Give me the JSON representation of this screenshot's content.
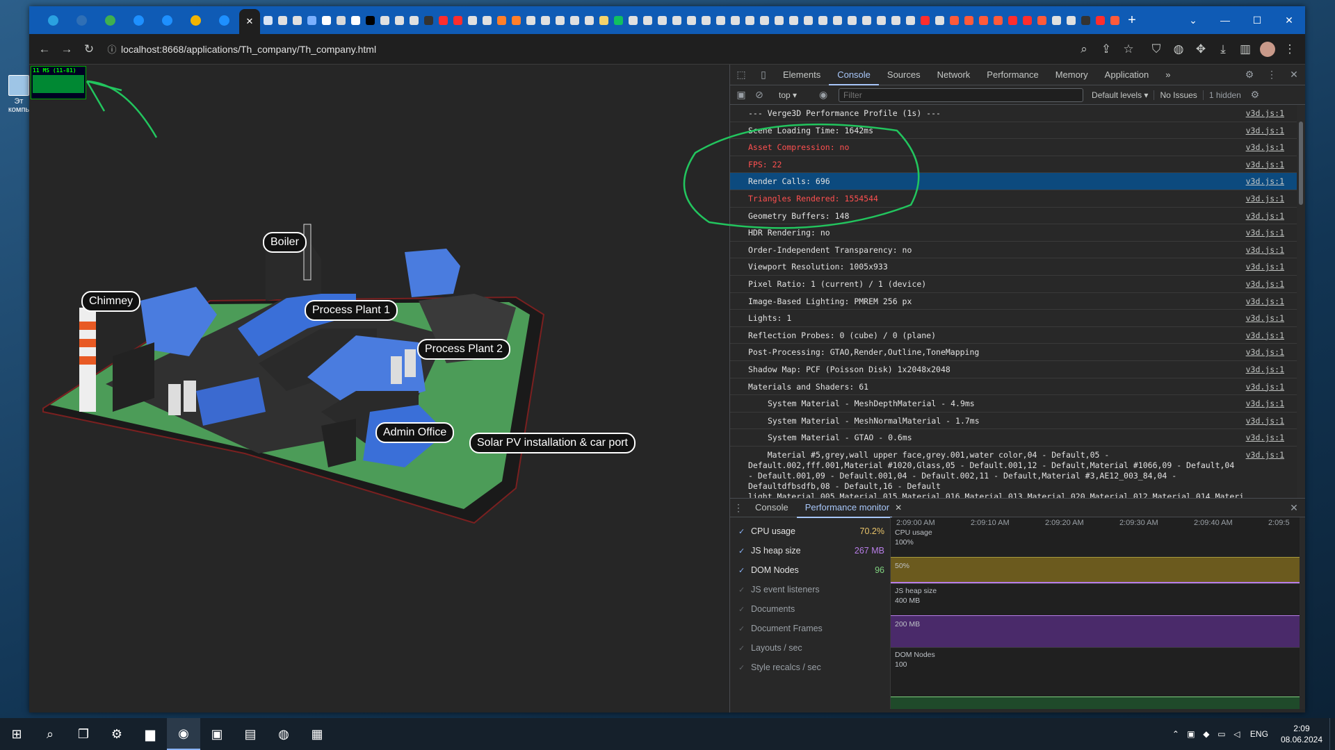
{
  "desktop": {
    "icon_label": "Эт компь"
  },
  "browser": {
    "tab_strip": {
      "pinned_tabs": [
        {
          "icon": "telegram-icon",
          "color": "#2aa1e0"
        },
        {
          "icon": "vk-icon",
          "color": "#2f6fb5",
          "glyph": "VK"
        },
        {
          "icon": "circle-icon",
          "color": "#3fb04f"
        },
        {
          "icon": "vpn-icon",
          "color": "#1e90ff"
        },
        {
          "icon": "vpn-icon",
          "color": "#1e90ff"
        },
        {
          "icon": "mail-icon",
          "color": "#f2b400"
        },
        {
          "icon": "vpn-icon",
          "color": "#1e90ff"
        }
      ],
      "active_tab": {
        "glyph": "✕"
      },
      "other_tab_colors": [
        "#d7e4f5",
        "#e0e0e0",
        "#e0e0e0",
        "#7ab0ff",
        "#ffffff",
        "#d9d9d9",
        "#ffffff",
        "#000000",
        "#e0e0e0",
        "#e0e0e0",
        "#e0e0e0",
        "#333333",
        "#ff2d2d",
        "#ff2d2d",
        "#e0e0e0",
        "#e0e0e0",
        "#ff7f2a",
        "#ff7f2a",
        "#e0e0e0",
        "#e0e0e0",
        "#e0e0e0",
        "#e0e0e0",
        "#e0e0e0",
        "#f5d36b",
        "#10c060",
        "#e0e0e0",
        "#e0e0e0",
        "#e0e0e0",
        "#e0e0e0",
        "#e0e0e0",
        "#e0e0e0",
        "#e0e0e0",
        "#e0e0e0",
        "#e0e0e0",
        "#e0e0e0",
        "#e0e0e0",
        "#e0e0e0",
        "#e0e0e0",
        "#e0e0e0",
        "#e0e0e0",
        "#e0e0e0",
        "#e0e0e0",
        "#e0e0e0",
        "#e0e0e0",
        "#e0e0e0",
        "#ff2d2d",
        "#e0e0e0",
        "#ff5a3a",
        "#ff5a3a",
        "#ff5a3a",
        "#ff5a3a",
        "#ff2d2d",
        "#ff2d2d",
        "#ff5a3a",
        "#e0e0e0",
        "#e0e0e0",
        "#333333",
        "#ff2d2d",
        "#ff5a3a"
      ],
      "new_tab": "+"
    },
    "window_controls": {
      "tab_search": "⌄",
      "minimize": "—",
      "maximize": "☐",
      "close": "✕"
    },
    "url": "localhost:8668/applications/Th_company/Th_company.html"
  },
  "viewport": {
    "perf_overlay_text": "11 MS (11-81)",
    "labels": {
      "boiler": "Boiler",
      "chimney": "Chimney",
      "process_plant_1": "Process Plant 1",
      "process_plant_2": "Process Plant 2",
      "admin_office": "Admin Office",
      "solar_pv": "Solar PV installation & car port"
    }
  },
  "devtools": {
    "tabs": [
      "Elements",
      "Console",
      "Sources",
      "Network",
      "Performance",
      "Memory",
      "Application"
    ],
    "active_tab": "Console",
    "more": "»",
    "console_toolbar": {
      "context": "top ▾",
      "filter_placeholder": "Filter",
      "levels": "Default levels ▾",
      "issues": "No Issues",
      "hidden": "1 hidden"
    },
    "log": [
      {
        "text": "--- Verge3D Performance Profile (1s) ---",
        "src": "v3d.js:1",
        "type": "info"
      },
      {
        "text": "Scene Loading Time: 1642ms",
        "src": "v3d.js:1",
        "type": "info"
      },
      {
        "text": "Asset Compression: no",
        "src": "v3d.js:1",
        "type": "error"
      },
      {
        "text": "FPS: 22",
        "src": "v3d.js:1",
        "type": "error"
      },
      {
        "text": "Render Calls: 696",
        "src": "v3d.js:1",
        "type": "selected"
      },
      {
        "text": "Triangles Rendered: 1554544",
        "src": "v3d.js:1",
        "type": "error"
      },
      {
        "text": "Geometry Buffers: 148",
        "src": "v3d.js:1",
        "type": "info"
      },
      {
        "text": "HDR Rendering: no",
        "src": "v3d.js:1",
        "type": "info"
      },
      {
        "text": "Order-Independent Transparency: no",
        "src": "v3d.js:1",
        "type": "info"
      },
      {
        "text": "Viewport Resolution: 1005x933",
        "src": "v3d.js:1",
        "type": "info"
      },
      {
        "text": "Pixel Ratio: 1 (current) / 1 (device)",
        "src": "v3d.js:1",
        "type": "info"
      },
      {
        "text": "Image-Based Lighting: PMREM 256 px",
        "src": "v3d.js:1",
        "type": "info"
      },
      {
        "text": "Lights: 1",
        "src": "v3d.js:1",
        "type": "info"
      },
      {
        "text": "Reflection Probes: 0 (cube) / 0 (plane)",
        "src": "v3d.js:1",
        "type": "info"
      },
      {
        "text": "Post-Processing: GTAO,Render,Outline,ToneMapping",
        "src": "v3d.js:1",
        "type": "info"
      },
      {
        "text": "Shadow Map: PCF (Poisson Disk) 1x2048x2048",
        "src": "v3d.js:1",
        "type": "info"
      },
      {
        "text": "Materials and Shaders: 61",
        "src": "v3d.js:1",
        "type": "info"
      },
      {
        "text": "System Material - MeshDepthMaterial - 4.9ms",
        "src": "v3d.js:1",
        "type": "indent"
      },
      {
        "text": "System Material - MeshNormalMaterial - 1.7ms",
        "src": "v3d.js:1",
        "type": "indent"
      },
      {
        "text": "System Material - GTAO - 0.6ms",
        "src": "v3d.js:1",
        "type": "indent"
      },
      {
        "text": "    Material #5,grey,wall upper face,grey.001,water color,04 - Default,05 - Default.002,fff.001,Material #1020,Glass,05 - Default.001,12 - Default,Material #1066,09 - Default,04 - Default.001,09 - Default.001,04 - Default.002,11 - Default,Material #3,AE12_003_84,04 - Defaultdfbsdfb,08 - Default,16 - Default light,Material.005,Material.015,Material.016,Material.013,Material.020,Material.012,Material.014,Materi",
        "src": "v3d.js:1",
        "type": "long"
      }
    ],
    "drawer": {
      "tabs": [
        "Console",
        "Performance monitor"
      ],
      "active": "Performance monitor",
      "metrics": [
        {
          "label": "CPU usage",
          "value": "70.2%",
          "color": "#e9c46a",
          "on": true
        },
        {
          "label": "JS heap size",
          "value": "267 MB",
          "color": "#b87ee8",
          "on": true
        },
        {
          "label": "DOM Nodes",
          "value": "96",
          "color": "#7fd17f",
          "on": true
        },
        {
          "label": "JS event listeners",
          "value": "",
          "on": false
        },
        {
          "label": "Documents",
          "value": "",
          "on": false
        },
        {
          "label": "Document Frames",
          "value": "",
          "on": false
        },
        {
          "label": "Layouts / sec",
          "value": "",
          "on": false
        },
        {
          "label": "Style recalcs / sec",
          "value": "",
          "on": false
        }
      ],
      "time_ticks": [
        "2:09:00 AM",
        "2:09:10 AM",
        "2:09:20 AM",
        "2:09:30 AM",
        "2:09:40 AM",
        "2:09:5"
      ],
      "charts": {
        "cpu": {
          "title": "CPU usage",
          "max_label": "100%",
          "mid_label": "50%",
          "level_fraction": 0.48,
          "fill": "#6b5a1e",
          "line": "#a89a3c"
        },
        "heap": {
          "title": "JS heap size",
          "max_label": "400 MB",
          "mid_label": "200 MB",
          "level_fraction": 0.52,
          "fill": "#4a2a6a",
          "line": "#b87ee8"
        },
        "dom": {
          "title": "DOM Nodes",
          "max_label": "100",
          "fill": "#1f4a2a",
          "line": "#7fd17f"
        }
      }
    }
  },
  "taskbar": {
    "apps": [
      "start-icon",
      "search-icon",
      "task-view-icon",
      "settings-icon",
      "file-explorer-icon",
      "browser-icon",
      "save-icon",
      "app-icon",
      "vpn-icon",
      "notepad-icon"
    ],
    "tray": {
      "lang": "ENG",
      "time": "2:09",
      "date": "08.06.2024"
    }
  }
}
